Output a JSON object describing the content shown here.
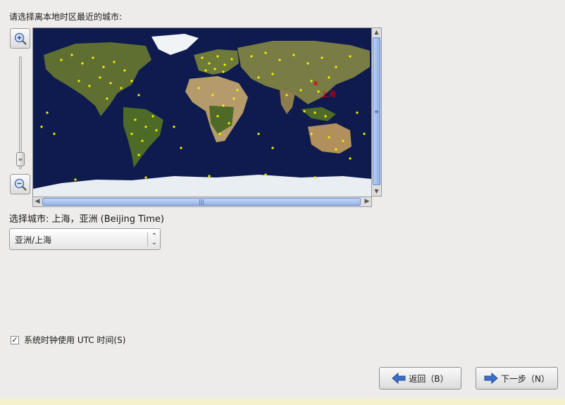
{
  "prompt": "请选择离本地时区最近的城市:",
  "map": {
    "selected_city_label": "上海",
    "selected_marker": "x",
    "colors": {
      "ocean": "#0f1b4e",
      "land": "#6d7a3a",
      "desert": "#c2a878",
      "ice": "#e8eef2",
      "city_dot": "#f2f200",
      "selected": "#e00000"
    }
  },
  "zoom": {
    "in_icon": "zoom-in-icon",
    "out_icon": "zoom-out-icon"
  },
  "selected_city_text": "选择城市: 上海，亚洲 (Beijing Time)",
  "timezone_select": {
    "value": "亚洲/上海"
  },
  "utc_checkbox": {
    "checked": true,
    "label": "系统时钟使用 UTC 时间(S)"
  },
  "buttons": {
    "back": {
      "label": "返回（B）",
      "icon": "arrow-left-icon"
    },
    "next": {
      "label": "下一步（N）",
      "icon": "arrow-right-icon"
    }
  }
}
